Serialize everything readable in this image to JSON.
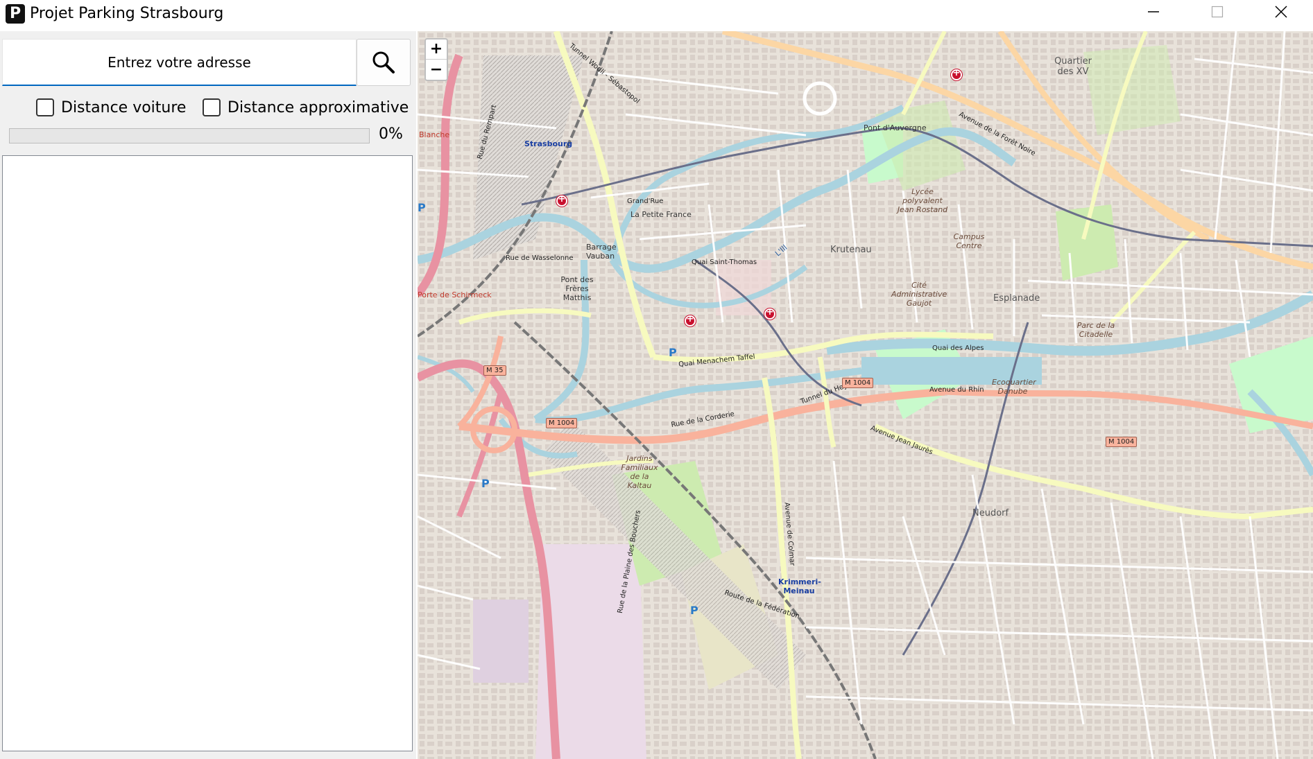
{
  "window": {
    "app_icon": "P",
    "title": "Projet Parking Strasbourg",
    "minimize_icon": "minimize-icon",
    "maximize_icon": "maximize-icon",
    "close_icon": "close-icon"
  },
  "search": {
    "address_placeholder": "Entrez votre adresse",
    "button_icon": "search-icon"
  },
  "options": {
    "car_distance_label": "Distance voiture",
    "car_distance_checked": false,
    "approx_distance_label": "Distance approximative",
    "approx_distance_checked": false
  },
  "progress": {
    "value": 0,
    "text": "0%"
  },
  "results": {
    "items": []
  },
  "map": {
    "zoom_in": "+",
    "zoom_out": "−",
    "labels": {
      "strasbourg": "Strasbourg",
      "petite_france": "La Petite France",
      "krutenau": "Krutenau",
      "esplanade": "Esplanade",
      "neudorf": "Neudorf",
      "pont_auvergne": "Pont d'Auvergne",
      "quartier_xv": "Quartier des XV",
      "campus": "Campus Centre",
      "barrage": "Barrage Vauban",
      "pont_freres": "Pont des Frères Matthis",
      "krimmeri": "Krimmeri-Meinau",
      "lycee": "Lycée polyvalent Jean Rostand",
      "cite_admin": "Cité Administrative Gaujot",
      "parc_citadelle": "Parc de la Citadelle",
      "jardins": "Jardins Familiaux de la Kaltau",
      "ecoquartier": "Ecoquartier Danube",
      "porte_schirmeck": "Porte de Schirmeck",
      "quai_alpes": "Quai des Alpes",
      "avenue_rhin": "Avenue du Rhin",
      "avenue_foret_noire": "Avenue de la Forêt Noire",
      "avenue_jean_jaures": "Avenue Jean Jaurès",
      "quai_menachem": "Quai Menachem Taffel",
      "tunnel_heyritz": "Tunnel du Heyritz",
      "rue_corderie": "Rue de la Corderie",
      "rue_wasselonne": "Rue de Wasselonne",
      "grand_rue": "Grand'Rue",
      "quai_st_thomas": "Quai Saint-Thomas",
      "tunnel_wodli": "Tunnel Wodli - Sébastopol",
      "rue_rempart": "Rue du Rempart",
      "avenue_colmar": "Avenue de Colmar",
      "route_federation": "Route de la Fédération",
      "rue_bouchers": "Rue de la Plaine des Bouchers",
      "m35": "M 35",
      "m1004_a": "M 1004",
      "m1004_b": "M 1004",
      "m1004_c": "M 1004",
      "blanche": "Blanche",
      "ill": "L'Ill"
    },
    "parking_symbol": "P",
    "colors": {
      "background": "#f2efe9",
      "water": "#aad3df",
      "primary_road": "#fcd6a4",
      "motorway": "#e892a2",
      "trunk": "#f9b29c",
      "secondary": "#f7fabf",
      "park": "#c8facc",
      "building": "#d9d0c9",
      "railway": "#999999",
      "industrial": "#ebdbe8"
    }
  }
}
